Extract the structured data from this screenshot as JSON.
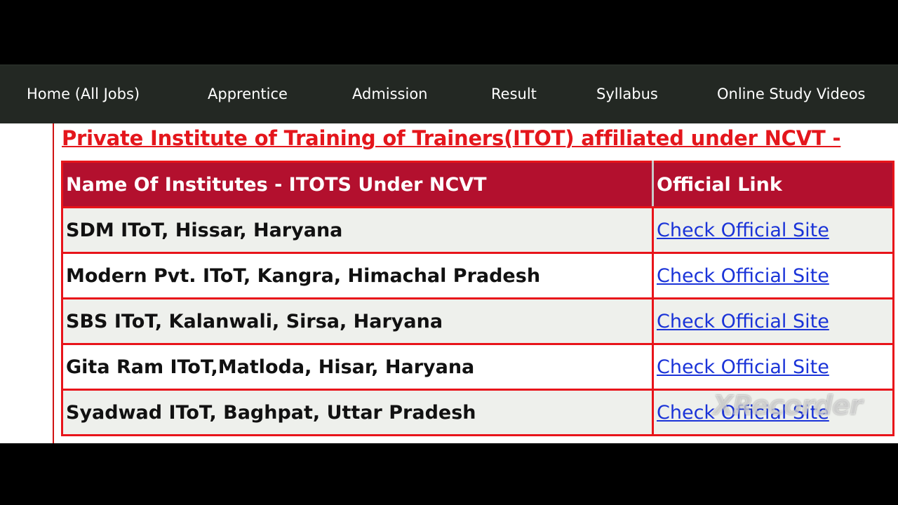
{
  "nav": {
    "items": [
      {
        "label": "Home (All Jobs)"
      },
      {
        "label": "Apprentice"
      },
      {
        "label": "Admission"
      },
      {
        "label": "Result"
      },
      {
        "label": "Syllabus"
      },
      {
        "label": "Online Study Videos"
      }
    ]
  },
  "heading": "Private Institute of Training of Trainers(ITOT) affiliated under NCVT -",
  "table": {
    "headers": [
      "Name Of Institutes - ITOTS Under NCVT",
      "Official Link"
    ],
    "rows": [
      {
        "name": "SDM IToT, Hissar, Haryana",
        "link": "Check Official Site"
      },
      {
        "name": "Modern Pvt. IToT, Kangra, Himachal Pradesh",
        "link": "Check Official Site"
      },
      {
        "name": "SBS IToT, Kalanwali, Sirsa, Haryana",
        "link": "Check Official Site"
      },
      {
        "name": "Gita Ram IToT,Matloda, Hisar, Haryana",
        "link": "Check Official Site"
      },
      {
        "name": "Syadwad IToT, Baghpat, Uttar Pradesh",
        "link": "Check Official Site"
      }
    ]
  },
  "watermark": "XRecorder",
  "colors": {
    "nav_bg": "#232823",
    "heading": "#e4161c",
    "table_header_bg": "#b3102e",
    "table_border": "#e8141a",
    "link": "#1a33d8"
  }
}
